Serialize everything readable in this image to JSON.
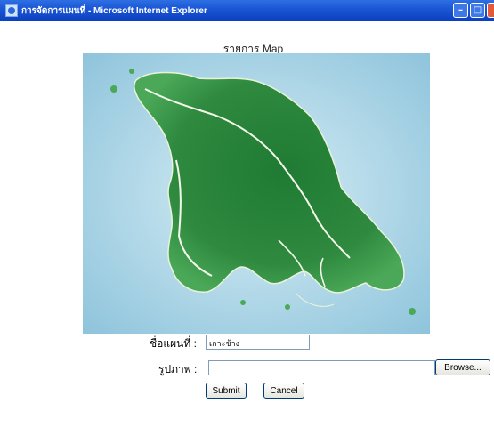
{
  "window": {
    "title": "การจัดการแผนที่ - Microsoft Internet Explorer",
    "min_glyph": "–",
    "max_glyph": "□"
  },
  "page": {
    "heading": "รายการ Map"
  },
  "map": {
    "island_color": "#2f8a3f",
    "sea_color": "#c9e6f0"
  },
  "form": {
    "map_name_label": "ชื่อแผนที่ :",
    "map_name_value": "เกาะช้าง",
    "image_label": "รูปภาพ :",
    "image_value": "",
    "browse_label": "Browse...",
    "submit_label": "Submit",
    "cancel_label": "Cancel"
  }
}
